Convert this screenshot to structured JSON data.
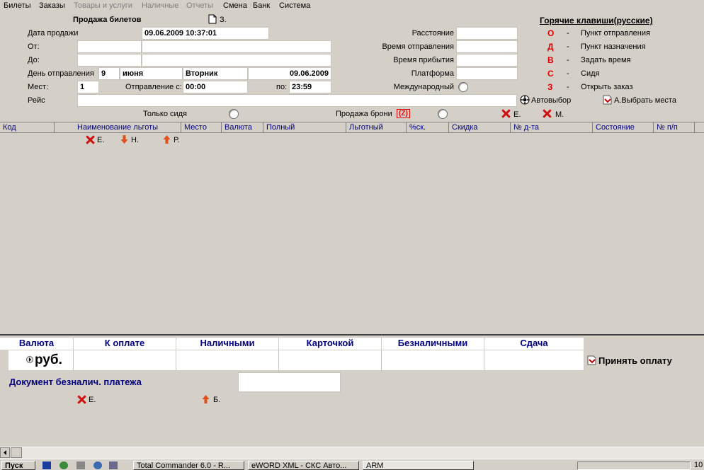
{
  "menu": {
    "items": [
      {
        "label": "Билеты",
        "enabled": true
      },
      {
        "label": "Заказы",
        "enabled": true
      },
      {
        "label": "Товары и услуги",
        "enabled": false
      },
      {
        "label": "Наличные",
        "enabled": false
      },
      {
        "label": "Отчеты",
        "enabled": false
      },
      {
        "label": "Смена",
        "enabled": true
      },
      {
        "label": "Банк",
        "enabled": true
      },
      {
        "label": "Система",
        "enabled": true
      }
    ]
  },
  "form": {
    "title": "Продажа билетов",
    "title_button": "З.",
    "sale_date_label": "Дата продажи",
    "sale_date_value": "09.06.2009 10:37:01",
    "from_label": "От:",
    "to_label": "До:",
    "departure_day_label": "День отправления",
    "departure_day": "9",
    "departure_month": "июня",
    "departure_weekday": "Вторник",
    "departure_date": "09.06.2009",
    "seats_label": "Мест:",
    "seats_value": "1",
    "departure_from_label": "Отправление с:",
    "departure_from_value": "00:00",
    "departure_to_label": "по:",
    "departure_to_value": "23:59",
    "route_label": "Рейс",
    "distance_label": "Расстояние",
    "depart_time_label": "Время отправления",
    "arrive_time_label": "Время прибытия",
    "platform_label": "Платформа",
    "international_label": "Международный",
    "auto_select_label": "Автовыбор",
    "choose_seats_label": "А.Выбрать места",
    "only_seated_label": "Только сидя",
    "booking_sale_label": "Продажа брони",
    "booking_sale_key": "(Z)",
    "e_label": "Е.",
    "m_label": "М."
  },
  "hotkeys": {
    "title": "Горячие клавиши(русские)",
    "items": [
      {
        "key": "О",
        "desc": "Пункт отправления"
      },
      {
        "key": "Д",
        "desc": "Пункт назначения"
      },
      {
        "key": "В",
        "desc": "Задать время"
      },
      {
        "key": "С",
        "desc": "Сидя"
      },
      {
        "key": "З",
        "desc": "Открыть заказ"
      }
    ],
    "dash": "-"
  },
  "grid": {
    "columns": [
      "Код",
      "Наименование льготы",
      "Место",
      "Валюта",
      "Полный",
      "Льготный",
      "%ск.",
      "Скидка",
      "№ д-та",
      "Состояние",
      "№ п/п"
    ],
    "actions": {
      "delete": "Е.",
      "down": "Н.",
      "up": "Р."
    }
  },
  "payment": {
    "columns": [
      "Валюта",
      "К оплате",
      "Наличными",
      "Карточкой",
      "Безналичными",
      "Сдача"
    ],
    "currency": "руб.",
    "accept_label": "Принять оплату",
    "doc_label": "Документ безналич. платежа",
    "delete_label": "Е.",
    "b_label": "Б."
  },
  "taskbar": {
    "start": "Пуск",
    "tasks": [
      "Total Commander 6.0 - R...",
      "eWORD XML - СКС Авто...",
      "ARM"
    ],
    "clock": "10"
  },
  "colors": {
    "window_bg": "#d4d0c8",
    "header_text": "#000080",
    "hotkey": "#e00000"
  }
}
